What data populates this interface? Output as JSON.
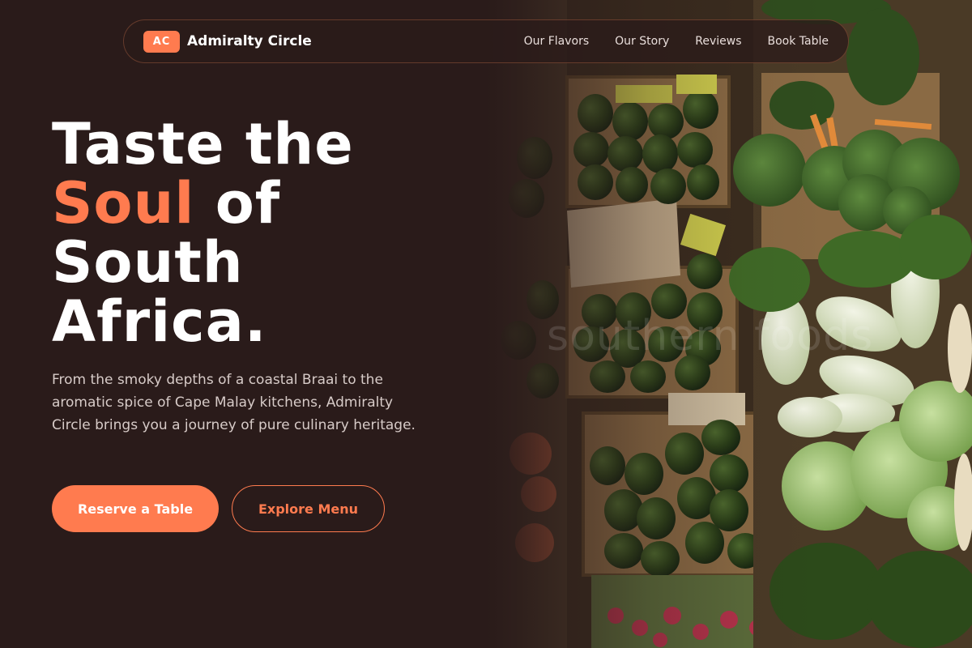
{
  "brand": {
    "badge": "AC",
    "name": "Admiralty Circle"
  },
  "nav": {
    "items": [
      {
        "label": "Our Flavors"
      },
      {
        "label": "Our Story"
      },
      {
        "label": "Reviews"
      },
      {
        "label": "Book Table"
      }
    ]
  },
  "hero": {
    "headline_line1": "Taste the",
    "headline_accent": "Soul",
    "headline_after_accent": " of",
    "headline_line3": "South",
    "headline_line4": "Africa.",
    "lead": "From the smoky depths of a coastal Braai to the aromatic spice of Cape Malay kitchens, Admiralty Circle brings you a journey of pure culinary heritage.",
    "primary_cta": "Reserve a Table",
    "secondary_cta": "Explore Menu",
    "image_watermark": "southern foods"
  },
  "colors": {
    "background": "#2a1b1a",
    "accent": "#ff7b4f",
    "text": "#ffffff",
    "muted_text": "#d7cbc8"
  },
  "icons": {
    "hero_image": "fresh-produce-market-photo"
  }
}
